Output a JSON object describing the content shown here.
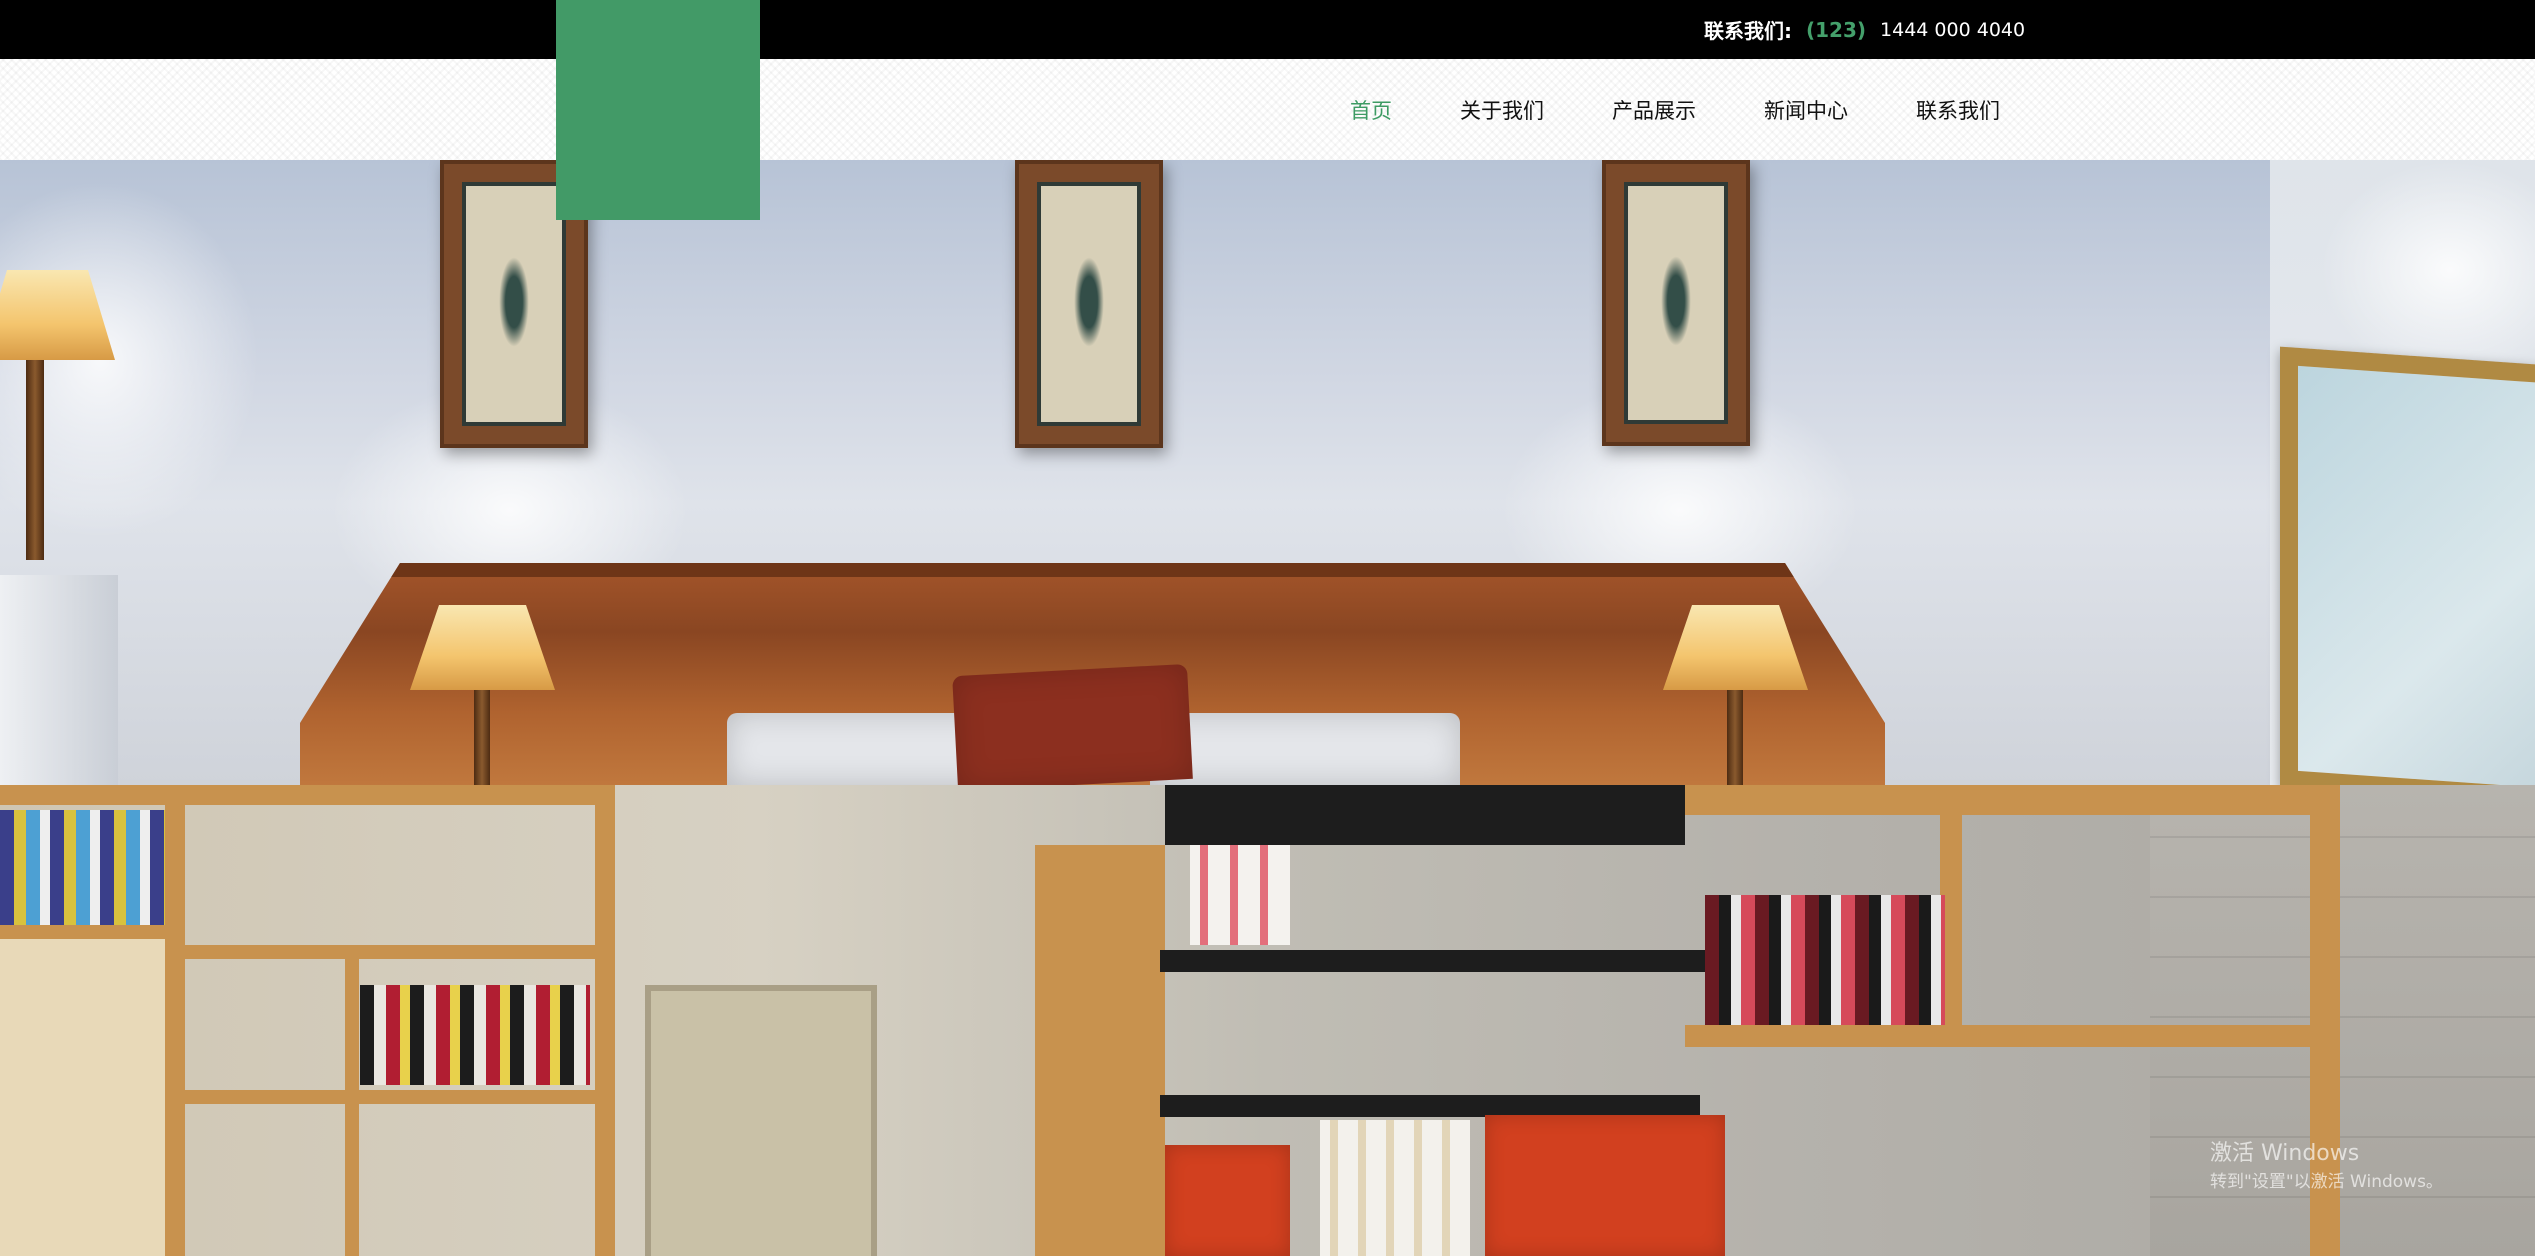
{
  "topbar": {
    "contact_label": "联系我们:",
    "phone_code": "(123)",
    "phone_number": "1444 000 4040"
  },
  "nav": {
    "items": [
      {
        "label": "首页",
        "active": true
      },
      {
        "label": "关于我们",
        "active": false
      },
      {
        "label": "产品展示",
        "active": false
      },
      {
        "label": "新闻中心",
        "active": false
      },
      {
        "label": "联系我们",
        "active": false
      }
    ]
  },
  "colors": {
    "brand_green": "#429a67",
    "active_nav": "#3d9b63",
    "topbar_bg": "#000000"
  },
  "hero_images": [
    {
      "alt": "bedroom-with-wood-headboard"
    },
    {
      "alt": "office-with-bookshelves"
    }
  ],
  "watermark": {
    "line1": "激活 Windows",
    "line2": "转到\"设置\"以激活 Windows。"
  }
}
